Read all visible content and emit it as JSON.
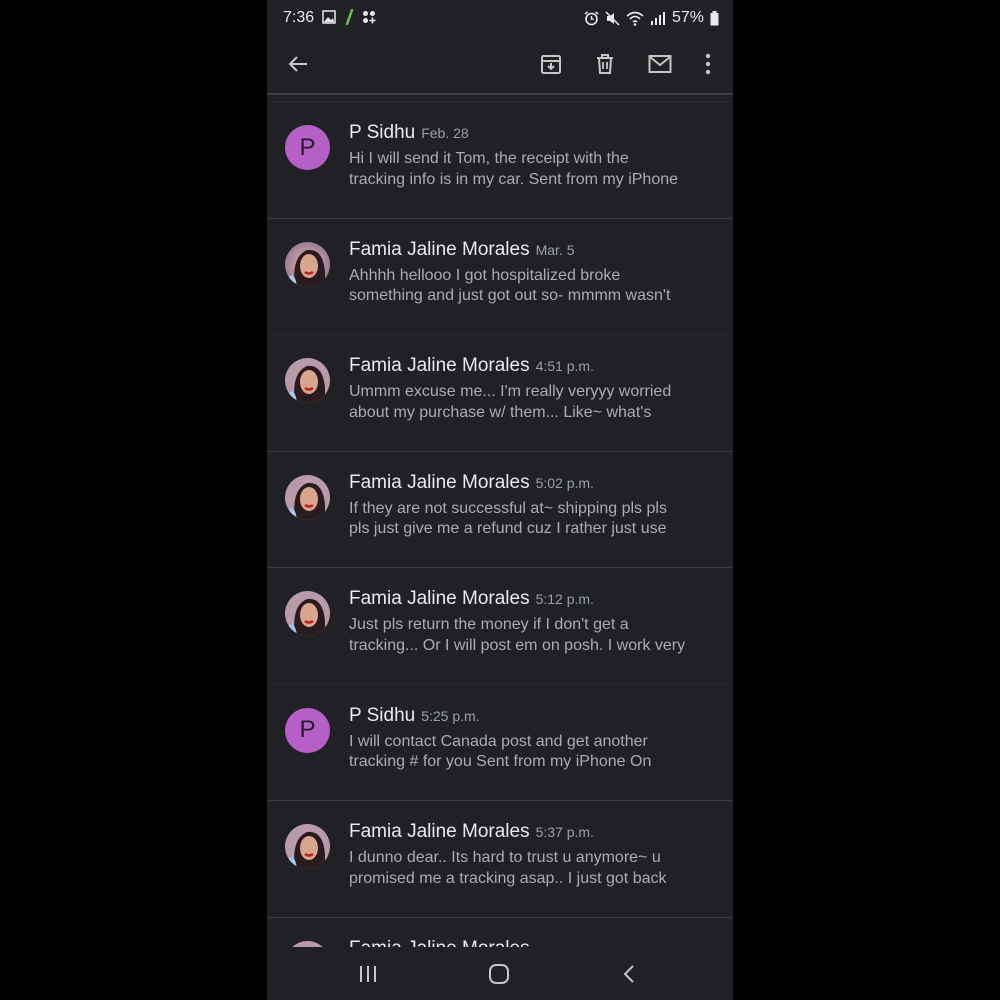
{
  "status_bar": {
    "time": "7:36",
    "battery": "57%"
  },
  "toolbar": {
    "back_icon": "arrow-left-icon",
    "archive_icon": "archive-icon",
    "delete_icon": "trash-icon",
    "mark_unread_icon": "mail-icon",
    "more_icon": "more-vert-icon"
  },
  "messages": [
    {
      "sender": "P Sidhu",
      "date": "Feb. 28",
      "avatar_letter": "P",
      "snippet_line1": "Hi I will send it Tom, the receipt with the",
      "snippet_line2": "tracking info is in my car. Sent from my iPhone"
    },
    {
      "sender": "Famia Jaline Morales",
      "date": "Mar. 5",
      "avatar_letter": "",
      "snippet_line1": "Ahhhh hellooo I got hospitalized broke",
      "snippet_line2": "something and just got out so- mmmm wasn't"
    },
    {
      "sender": "Famia Jaline Morales",
      "date": "4:51 p.m.",
      "avatar_letter": "",
      "snippet_line1": "Ummm excuse me... I'm really veryyy worried",
      "snippet_line2": "about my purchase w/ them... Like~ what's"
    },
    {
      "sender": "Famia Jaline Morales",
      "date": "5:02 p.m.",
      "avatar_letter": "",
      "snippet_line1": "If they are not successful at~ shipping pls pls",
      "snippet_line2": "pls just give me a refund cuz I rather just use"
    },
    {
      "sender": "Famia Jaline Morales",
      "date": "5:12 p.m.",
      "avatar_letter": "",
      "snippet_line1": "Just pls return the money if I don't get a",
      "snippet_line2": "tracking... Or I will post em on posh. I work very"
    },
    {
      "sender": "P Sidhu",
      "date": "5:25 p.m.",
      "avatar_letter": "P",
      "snippet_line1": "I will contact Canada post and get another",
      "snippet_line2": "tracking # for you Sent from my iPhone On"
    },
    {
      "sender": "Famia Jaline Morales",
      "date": "5:37 p.m.",
      "avatar_letter": "",
      "snippet_line1": "I dunno dear.. Its hard to trust u anymore~ u",
      "snippet_line2": "promised me a tracking asap.. I just got back"
    },
    {
      "sender": "Famia Jaline Morales",
      "date": "",
      "avatar_letter": "",
      "snippet_line1": "",
      "snippet_line2": ""
    }
  ],
  "colors": {
    "background": "#202124",
    "avatar_purple": "#b65fc7",
    "text_primary": "#e8eaed",
    "text_secondary": "#a9acb0"
  }
}
